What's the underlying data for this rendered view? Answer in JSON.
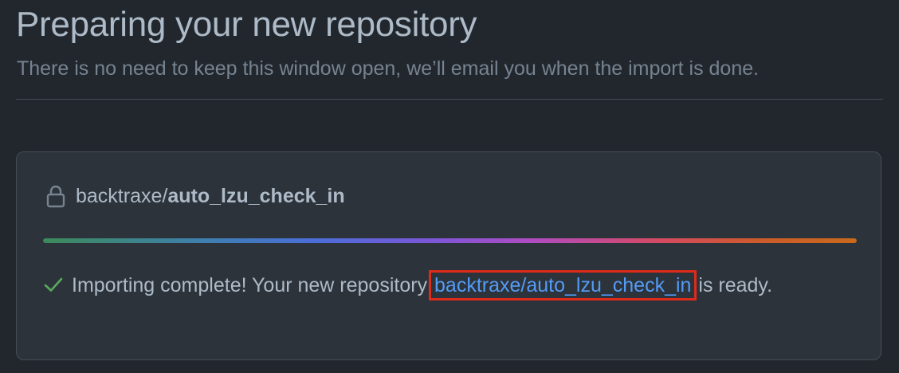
{
  "header": {
    "title": "Preparing your new repository",
    "subtitle": "There is no need to keep this window open, we’ll email you when the import is done."
  },
  "import": {
    "owner": "backtraxe",
    "separator": "/",
    "repo": "auto_lzu_check_in",
    "progress_fraction": 1.0,
    "message_before": "Importing complete! Your new repository ",
    "link_text": "backtraxe/auto_lzu_check_in",
    "message_after": " is ready."
  },
  "icons": {
    "lock": "lock-icon",
    "check": "check-icon"
  },
  "colors": {
    "background": "#22272e",
    "box_background": "#2d333b",
    "text": "#adbac7",
    "muted": "#768390",
    "link": "#539bf5",
    "success": "#57ab5a",
    "highlight": "#e02b1a"
  }
}
